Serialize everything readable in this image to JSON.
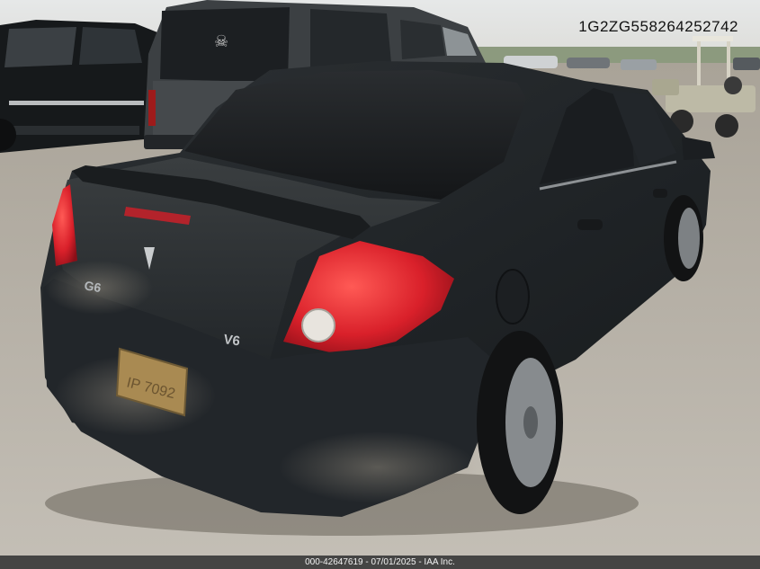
{
  "photo": {
    "vin_watermark": "1G2ZG558264252742",
    "footer_caption": "000-42647619 - 07/01/2025 - IAA Inc.",
    "vehicle_badges": {
      "model": "G6",
      "engine": "V6",
      "plate": "IP 7092"
    }
  }
}
